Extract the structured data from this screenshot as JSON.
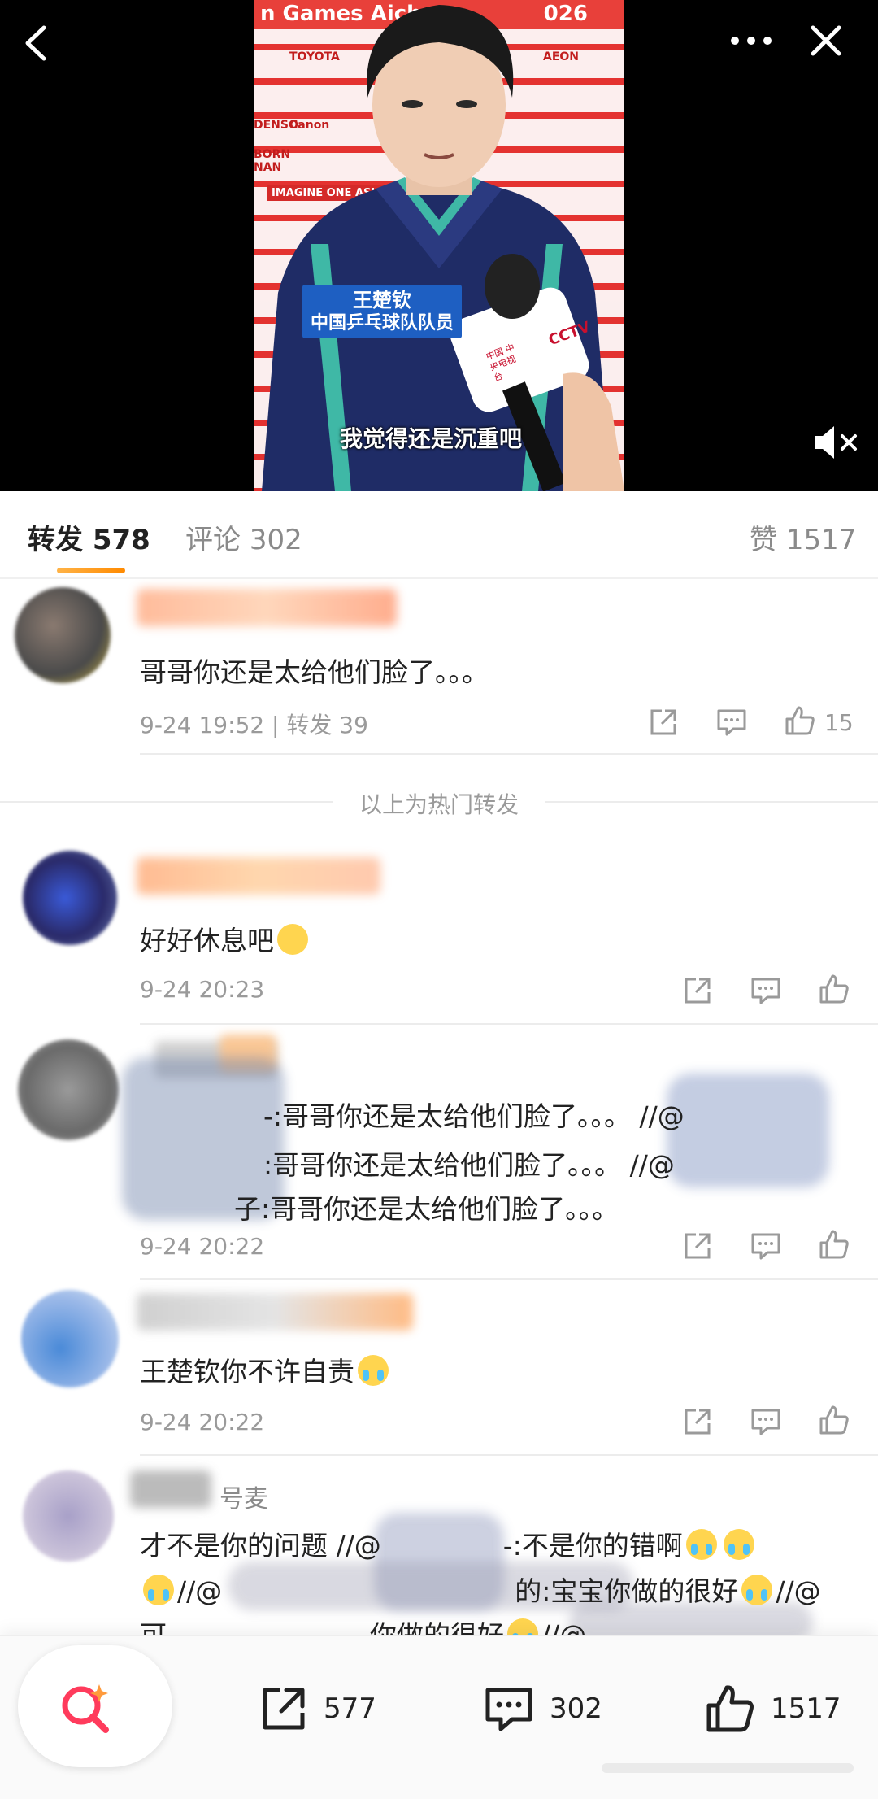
{
  "video": {
    "banner_text": "n Games Aich",
    "banner_year": "026",
    "caption_name": "王楚钦",
    "caption_title": "中国乒乓球队队员",
    "subtitle": "我觉得还是沉重吧",
    "sponsors": [
      "TOYOTA",
      "DENSO",
      "Canon",
      "BORN NAN",
      "AEON"
    ],
    "imagine_text": "IMAGINE ONE ASIA",
    "mic_logo": "CCTV",
    "mic_text": "中国 中央电视台"
  },
  "tabs": {
    "repost_label": "转发",
    "repost_count": "578",
    "comment_label": "评论",
    "comment_count": "302",
    "like_label": "赞",
    "like_count": "1517"
  },
  "hot_repost": {
    "text": "哥哥你还是太给他们脸了。。。",
    "time": "9-24 19:52",
    "repost": "转发 39",
    "likes": "15"
  },
  "separator_label": "以上为热门转发",
  "reposts": [
    {
      "text": "好好休息吧",
      "time": "9-24 20:23"
    },
    {
      "line1": "-:哥哥你还是太给他们脸了。。。 //@",
      "line2": ":哥哥你还是太给他们脸了。。。 //@",
      "line3": "子:哥哥你还是太给他们脸了。。。",
      "time": "9-24 20:22"
    },
    {
      "text": "王楚钦你不许自责",
      "time": "9-24 20:22"
    },
    {
      "line1a": "才不是你的问题 //@",
      "line1b": "-:不是你的错啊",
      "line2a": "//@",
      "line2b": "的:宝宝你做的很好",
      "line2c": "//@",
      "line3a": "可",
      "line3b": "你做的很好",
      "line3c": "//@",
      "name_suffix": "号麦"
    }
  ],
  "bottom_bar": {
    "repost_count": "577",
    "comment_count": "302",
    "like_count": "1517"
  },
  "colors": {
    "accent_orange": "#ff8a00",
    "fab_red": "#ff3b5c",
    "text_gray": "#9a9a9a"
  }
}
